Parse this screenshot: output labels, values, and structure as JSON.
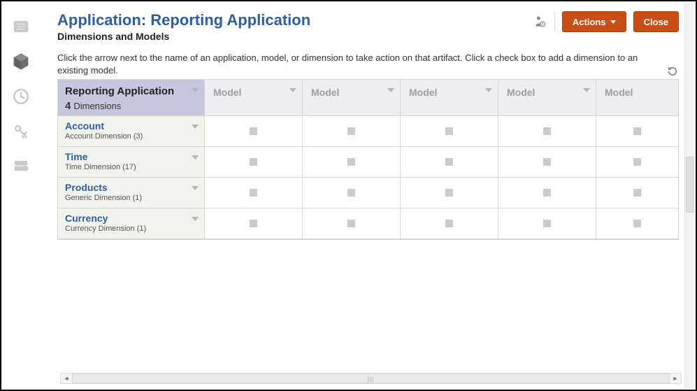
{
  "header": {
    "title": "Application: Reporting Application",
    "subtitle": "Dimensions and Models",
    "actions_label": "Actions",
    "close_label": "Close"
  },
  "instruction": "Click the arrow next to the name of an application, model, or dimension to take action on that artifact. Click a check box to add a dimension to an existing model.",
  "table": {
    "app_name": "Reporting Application",
    "dim_count_num": "4",
    "dim_count_label": "Dimensions",
    "model_cols": [
      "Model",
      "Model",
      "Model",
      "Model",
      "Model"
    ],
    "rows": [
      {
        "name": "Account",
        "sub": "Account Dimension  (3)"
      },
      {
        "name": "Time",
        "sub": "Time Dimension  (17)"
      },
      {
        "name": "Products",
        "sub": "Generic Dimension  (1)"
      },
      {
        "name": "Currency",
        "sub": "Currency Dimension  (1)"
      }
    ]
  },
  "vnav": {
    "items": [
      "list-icon",
      "cube-icon",
      "clock-icon",
      "key-icon",
      "server-icon"
    ],
    "active_index": 1
  }
}
